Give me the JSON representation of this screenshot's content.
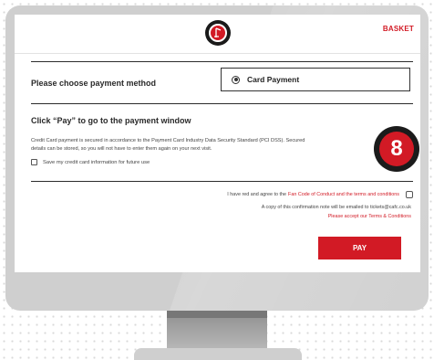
{
  "header": {
    "basket_label": "BASKET"
  },
  "payment": {
    "title": "Please choose payment method",
    "method_label": "Card Payment"
  },
  "instructions": {
    "title": "Click “Pay” to go to the payment window",
    "info_line1": "Credit Card payment is secured in accordance to the Payment Card Industry Data Security Standard (PCI DSS). Secured",
    "info_line2": "details can be stored, so you will not have to enter them again on your next visit.",
    "save_card_label": "Save my credit card information for future use"
  },
  "badge": {
    "number": "8"
  },
  "terms": {
    "agree_prefix": "I have red and agree to the",
    "agree_link": "Fan Code of Conduct and the terms and conditions",
    "copy_note": "A copy of this confirmation note will be emailed to tickets@cafc.co.uk",
    "accept_warning": "Please accept our Terms & Conditions"
  },
  "actions": {
    "pay_label": "PAY"
  },
  "colors": {
    "accent": "#d21a25",
    "text": "#2a2a2a",
    "monitor": "#cfcfcf"
  }
}
